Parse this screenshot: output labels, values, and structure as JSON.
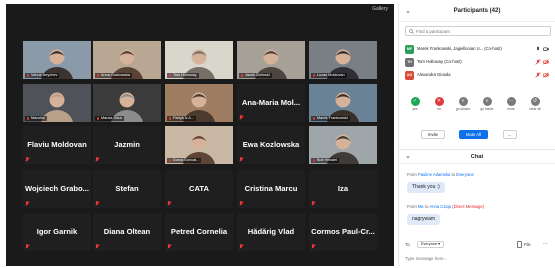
{
  "gallery": {
    "view_button": "Gallery",
    "tiles": [
      {
        "name": "Venus Neychev",
        "type": "video"
      },
      {
        "name": "Anna Grabowska",
        "type": "video"
      },
      {
        "name": "Tom Holloway",
        "type": "video"
      },
      {
        "name": "Jacek Zielinski",
        "type": "video"
      },
      {
        "name": "Lucas Moldovan",
        "type": "video"
      },
      {
        "name": "Marcela",
        "type": "video"
      },
      {
        "name": "Marcia Silva",
        "type": "video"
      },
      {
        "name": "Patryk & A...",
        "type": "video"
      },
      {
        "name": "Ana-Maria Mol...",
        "type": "name"
      },
      {
        "name": "Marek Frankowski",
        "type": "video",
        "active": true
      },
      {
        "name": "Flaviu Moldovan",
        "type": "name"
      },
      {
        "name": "Jazmin",
        "type": "name"
      },
      {
        "name": "Dorca Goncal...",
        "type": "video"
      },
      {
        "name": "Ewa Kozlowska",
        "type": "name"
      },
      {
        "name": "Bob Headel",
        "type": "video"
      },
      {
        "name": "Wojciech Grabo...",
        "type": "name"
      },
      {
        "name": "Stefan",
        "type": "name"
      },
      {
        "name": "CATA",
        "type": "name"
      },
      {
        "name": "Cristina Marcu",
        "type": "name"
      },
      {
        "name": "Iza",
        "type": "name"
      },
      {
        "name": "Igor Garnik",
        "type": "name"
      },
      {
        "name": "Diana Oltean",
        "type": "name"
      },
      {
        "name": "Petred Cornelia",
        "type": "name"
      },
      {
        "name": "Hădărig Vlad",
        "type": "name"
      },
      {
        "name": "Cormos Paul-Cr...",
        "type": "name"
      }
    ]
  },
  "participants": {
    "title": "Participants (42)",
    "search_placeholder": "Find a participant",
    "list": [
      {
        "initials": "MF",
        "name": "Marek Frankowski, Jagiellonian U... (Co-host)",
        "color": "#2e9d5a"
      },
      {
        "initials": "TH",
        "name": "Tom Holloway (Co-host)",
        "color": "#6f6f6f"
      },
      {
        "initials": "AG",
        "name": "Alexandra Gioada",
        "color": "#d94a37"
      }
    ],
    "reactions": [
      {
        "label": "yes",
        "icon": "check",
        "color": "#1aa850"
      },
      {
        "label": "no",
        "icon": "x",
        "color": "#e0393b"
      },
      {
        "label": "go slower",
        "icon": "slower",
        "color": "#7a7a7a"
      },
      {
        "label": "go faster",
        "icon": "faster",
        "color": "#7a7a7a"
      },
      {
        "label": "more",
        "icon": "more",
        "color": "#7a7a7a"
      },
      {
        "label": "clear all",
        "icon": "clear",
        "color": "#7a7a7a"
      }
    ],
    "invite_label": "Invite",
    "mute_all_label": "Mute All",
    "more_label": "..."
  },
  "chat": {
    "title": "Chat",
    "messages": [
      {
        "prefix": "From ",
        "sender": "Pauline Adamska",
        "mid": " to ",
        "recipient": "Everyone",
        "suffix": "",
        "text": "Thank you :)"
      },
      {
        "prefix": "From ",
        "sender": "Me",
        "mid": " to ",
        "recipient": "Anna Czaja",
        "suffix": " (Direct Message)",
        "text": "nagrywam"
      }
    ],
    "to_label": "To:",
    "to_value": "Everyone ▾",
    "file_label": "File",
    "more_label": "...",
    "input_placeholder": "Type message here..."
  },
  "colors": {
    "gallery_bg": "#1a1a1a",
    "accent": "#0e71eb",
    "active_speaker": "#d8e63a"
  }
}
